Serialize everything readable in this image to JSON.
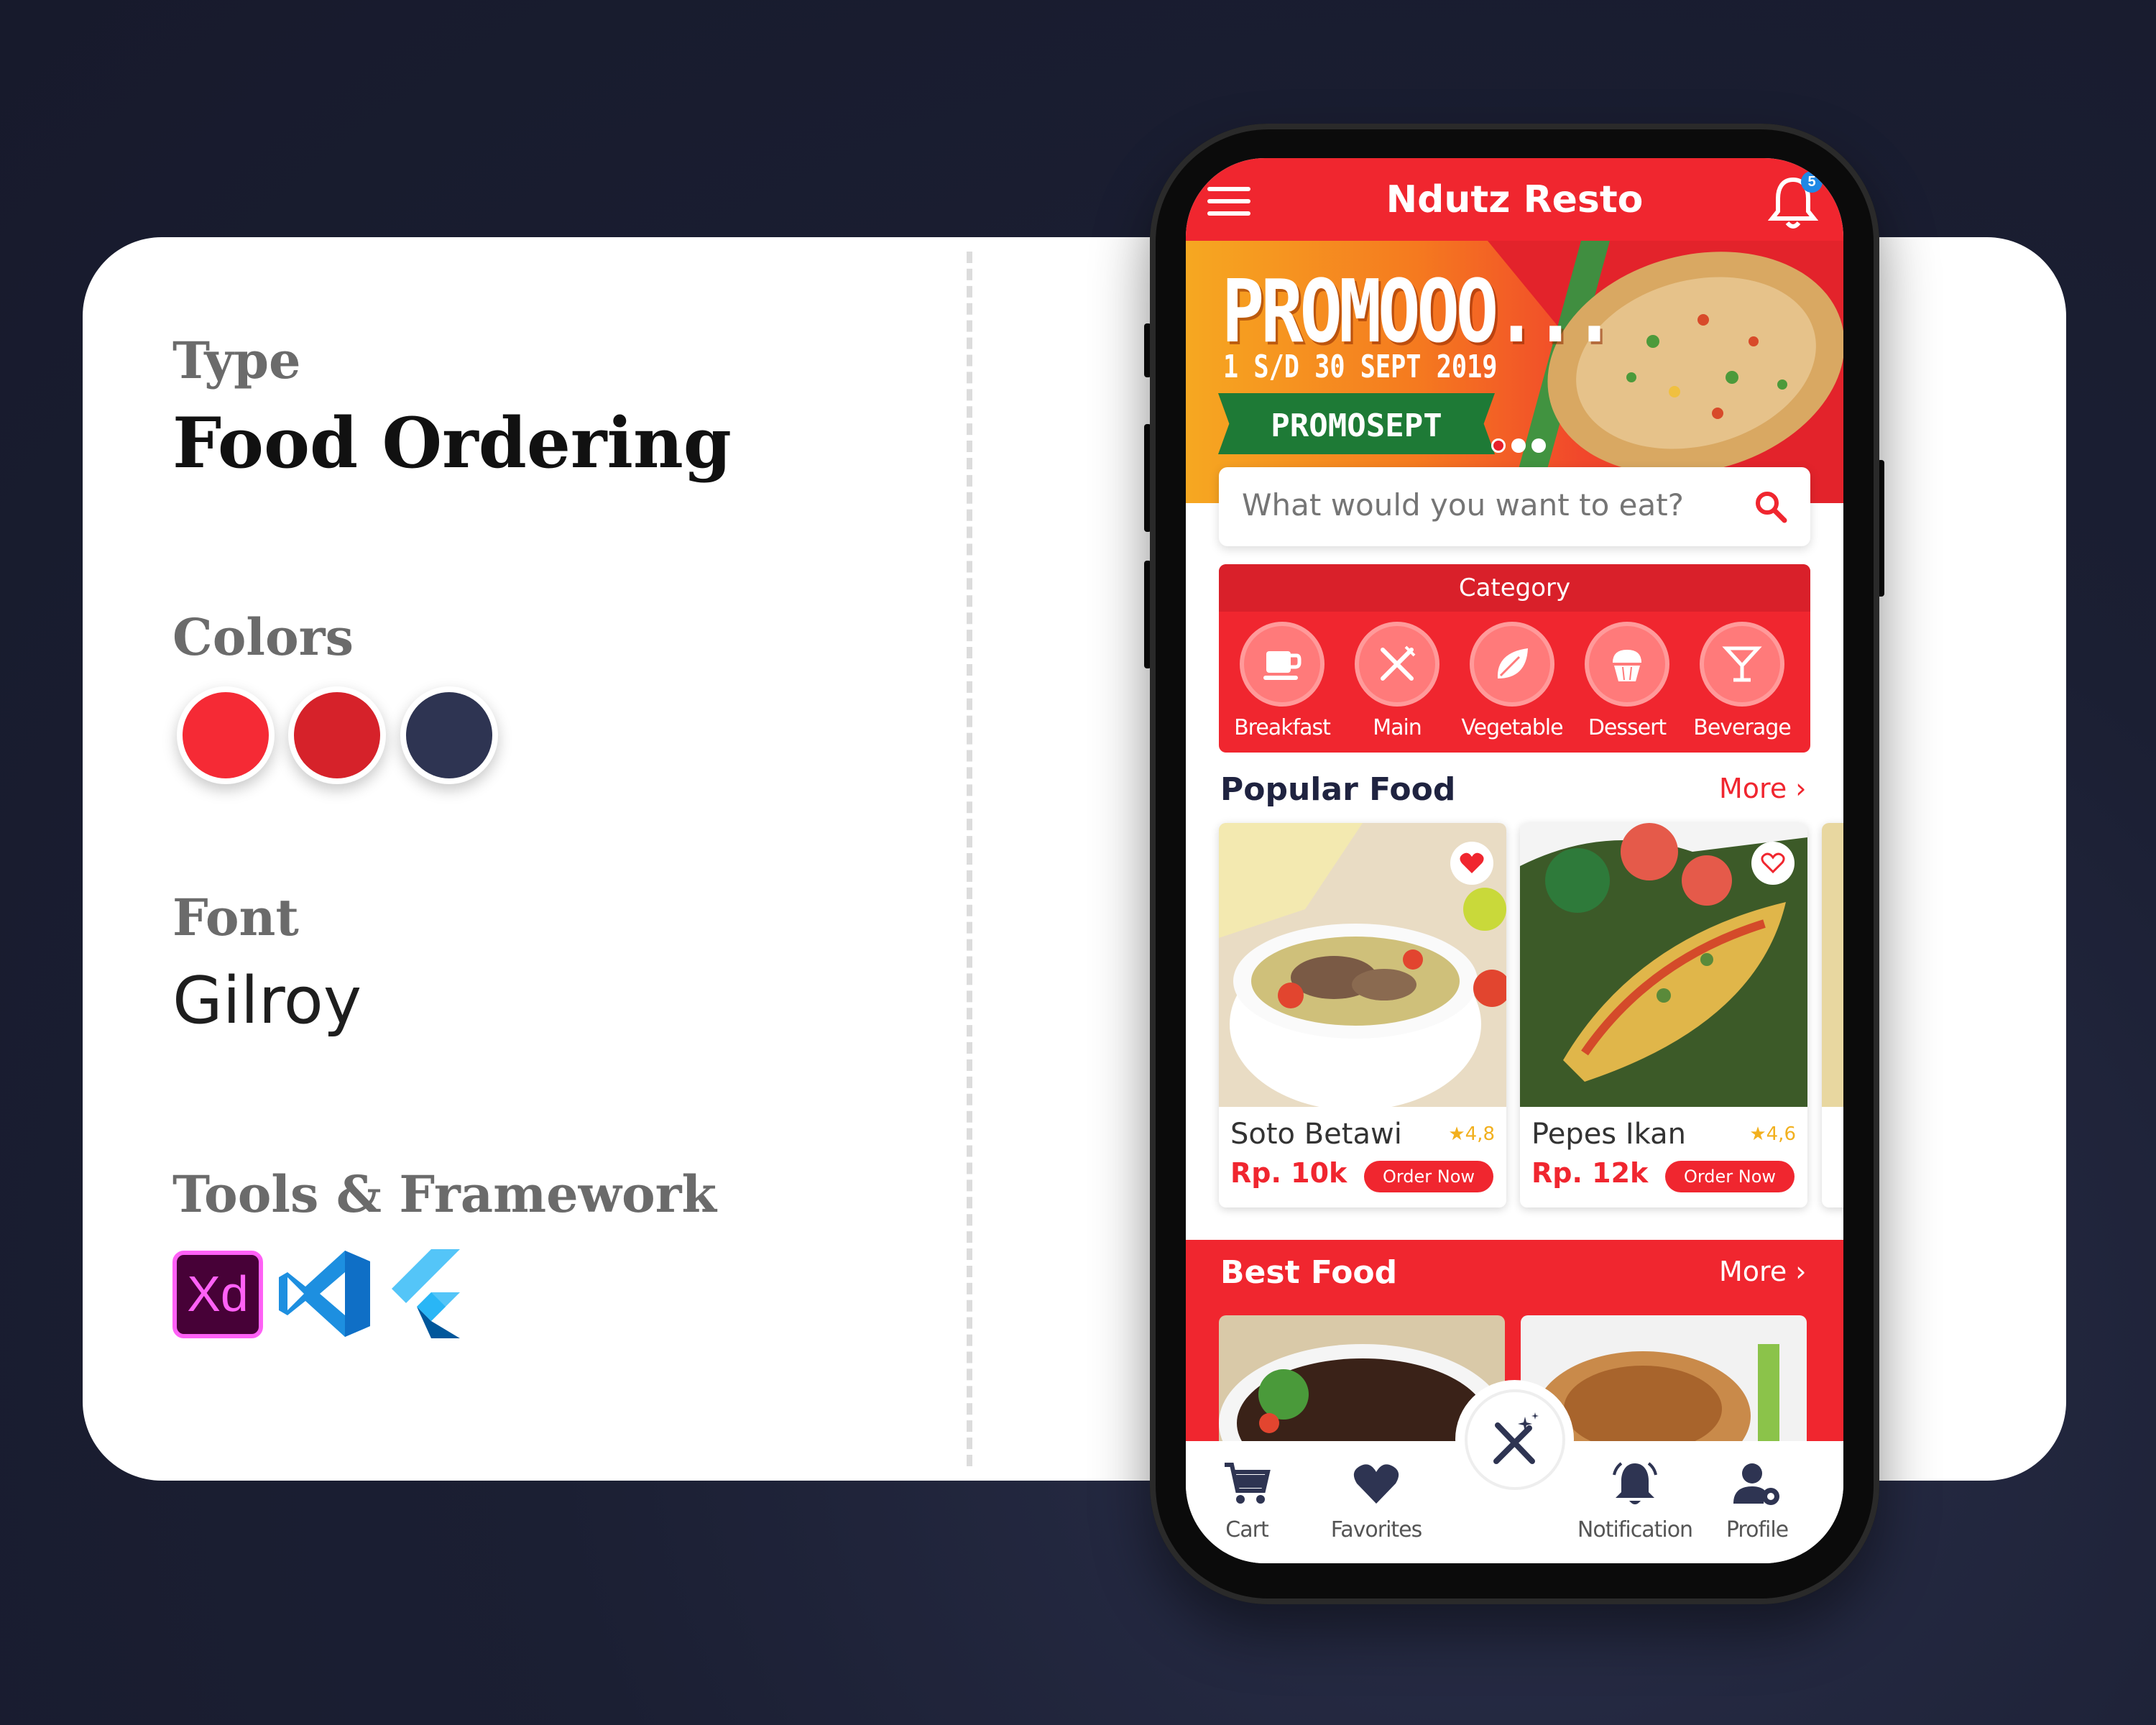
{
  "presentation": {
    "type_label": "Type",
    "type_value": "Food Ordering",
    "colors_label": "Colors",
    "colors": [
      "#f52a35",
      "#d6222a",
      "#2e3452"
    ],
    "font_label": "Font",
    "font_value": "Gilroy",
    "tools_label": "Tools & Framework",
    "tools": [
      {
        "name": "Xd",
        "icon": "adobe-xd-icon"
      },
      {
        "name": "",
        "icon": "vscode-icon"
      },
      {
        "name": "",
        "icon": "flutter-icon"
      }
    ]
  },
  "app": {
    "title": "Ndutz Resto",
    "notification_count": "5",
    "accent": "#f0262f",
    "banner": {
      "title": "PROMOOO...",
      "date": "1 S/D 30 SEPT 2019",
      "code": "PROMOSEPT",
      "slides": 3,
      "active_slide": 0
    },
    "search": {
      "placeholder": "What would you want to eat?"
    },
    "category": {
      "title": "Category",
      "items": [
        {
          "label": "Breakfast",
          "icon": "coffee-cup-icon"
        },
        {
          "label": "Main",
          "icon": "fork-knife-icon"
        },
        {
          "label": "Vegetable",
          "icon": "leaf-icon"
        },
        {
          "label": "Dessert",
          "icon": "cupcake-icon"
        },
        {
          "label": "Beverage",
          "icon": "cocktail-icon"
        }
      ]
    },
    "popular": {
      "title": "Popular Food",
      "more": "More",
      "items": [
        {
          "name": "Soto Betawi",
          "rating": "4,8",
          "price": "Rp. 10k",
          "order": "Order Now",
          "favorite": true
        },
        {
          "name": "Pepes Ikan",
          "rating": "4,6",
          "price": "Rp. 12k",
          "order": "Order Now",
          "favorite": false
        }
      ]
    },
    "best": {
      "title": "Best Food",
      "more": "More"
    },
    "nav": [
      {
        "label": "Cart",
        "icon": "cart-icon"
      },
      {
        "label": "Favorites",
        "icon": "heart-icon"
      },
      {
        "label": "Notification",
        "icon": "bell-icon"
      },
      {
        "label": "Profile",
        "icon": "user-settings-icon"
      }
    ]
  }
}
